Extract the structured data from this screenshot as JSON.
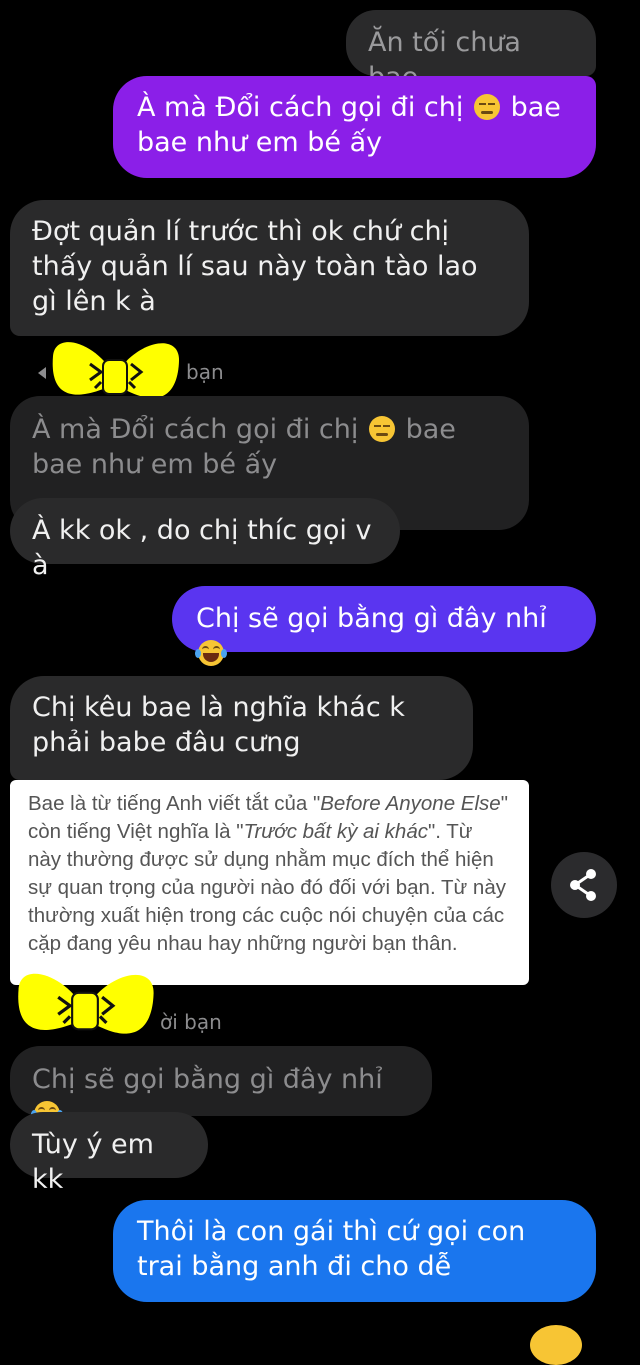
{
  "messages": {
    "m1": "Ăn tối chưa bae",
    "m2a": "À mà Đổi cách gọi đi chị",
    "m2b": "bae bae như em bé ấy",
    "m3": "Đợt quản lí trước thì ok chứ chị thấy quản lí sau này toàn tào lao gì lên k à",
    "reply1_label": "bạn",
    "quote1a": "À mà Đổi cách gọi đi chị",
    "quote1b": "bae bae như em bé ấy",
    "m4": "À kk ok , do chị thíc gọi v à",
    "m5": "Chị sẽ gọi bằng gì đây nhỉ",
    "m6": "Chị kêu bae là nghĩa khác k phải babe đâu cưng",
    "reply2_label": "ời bạn",
    "quote2": "Chị sẽ gọi bằng gì đây nhỉ",
    "m7": "Tùy ý em kk",
    "m8": "Thôi là con gái thì cứ gọi con trai bằng anh đi cho dễ"
  },
  "card": {
    "t1": "Bae là từ tiếng Anh viết tắt của \"",
    "t2": "Before Anyone Else",
    "t3": "\" còn tiếng Việt nghĩa là \"",
    "t4": "Trước bất kỳ ai khác",
    "t5": "\". Từ này thường được sử dụng nhằm mục đích thể hiện sự quan trọng của người nào đó đối với bạn. Từ này thường xuất hiện trong các cuộc nói chuyện của các cặp đang yêu nhau hay những người bạn thân."
  },
  "icons": {
    "meh": "expressionless-face-icon",
    "laugh": "face-with-tears-of-joy-icon",
    "share": "share-icon",
    "bow": "yellow-bow-sticker"
  },
  "colors": {
    "purple": "#8b1fe8",
    "violet": "#5a35f0",
    "blue": "#1a76ee",
    "dark_bubble": "#2a2a2b",
    "bow": "#ffff00"
  }
}
